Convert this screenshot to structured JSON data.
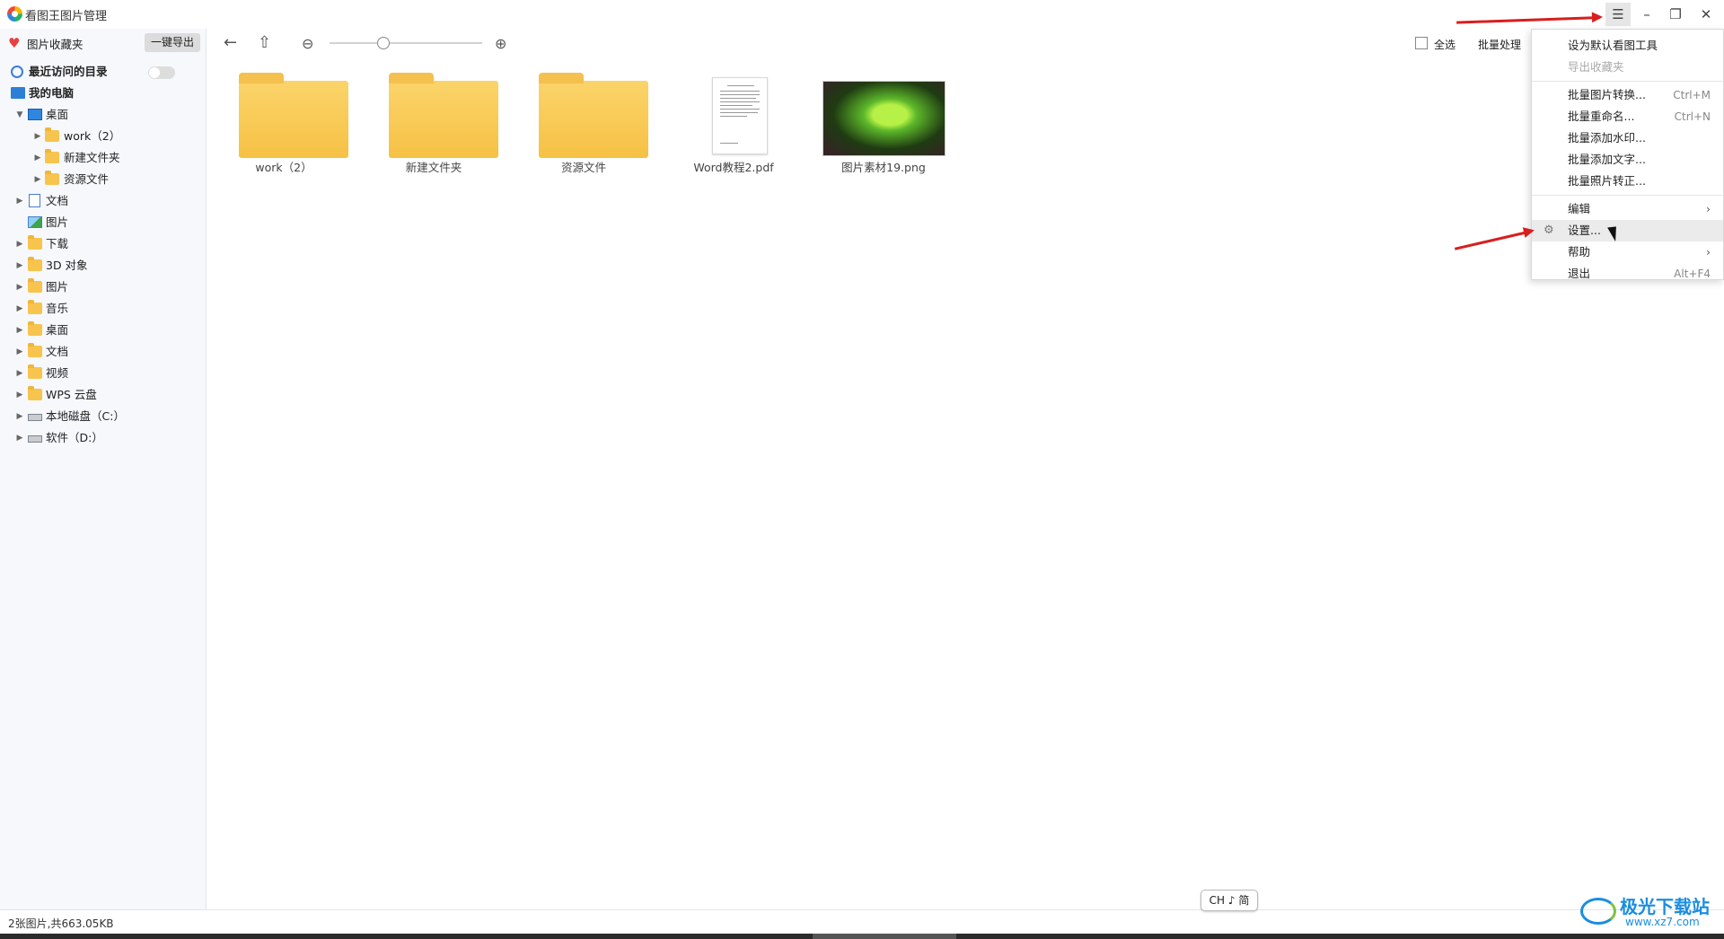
{
  "app": {
    "title": "看图王图片管理"
  },
  "sidebar": {
    "favorites_label": "图片收藏夹",
    "export_button": "一键导出",
    "recent_label": "最近访问的目录",
    "tree": [
      {
        "label": "我的电脑",
        "icon": "computer-icon"
      },
      {
        "label": "桌面",
        "icon": "desktop-icon"
      },
      {
        "label": "work（2）",
        "icon": "folder-icon"
      },
      {
        "label": "新建文件夹",
        "icon": "folder-icon"
      },
      {
        "label": "资源文件",
        "icon": "folder-icon"
      },
      {
        "label": "文档",
        "icon": "document-icon"
      },
      {
        "label": "图片",
        "icon": "picture-icon"
      },
      {
        "label": "下载",
        "icon": "folder-icon"
      },
      {
        "label": "3D 对象",
        "icon": "folder-icon"
      },
      {
        "label": "图片",
        "icon": "folder-icon"
      },
      {
        "label": "音乐",
        "icon": "folder-icon"
      },
      {
        "label": "桌面",
        "icon": "folder-icon"
      },
      {
        "label": "文档",
        "icon": "folder-icon"
      },
      {
        "label": "视频",
        "icon": "folder-icon"
      },
      {
        "label": "WPS 云盘",
        "icon": "folder-icon"
      },
      {
        "label": "本地磁盘（C:）",
        "icon": "drive-icon"
      },
      {
        "label": "软件（D:）",
        "icon": "drive-icon"
      }
    ]
  },
  "toolbar": {
    "select_all": "全选",
    "batch": "批量处理"
  },
  "files": [
    {
      "name": "work（2）",
      "kind": "folder"
    },
    {
      "name": "新建文件夹",
      "kind": "folder"
    },
    {
      "name": "资源文件",
      "kind": "folder"
    },
    {
      "name": "Word教程2.pdf",
      "kind": "pdf"
    },
    {
      "name": "图片素材19.png",
      "kind": "image"
    }
  ],
  "menu": {
    "items": [
      {
        "label": "设为默认看图工具",
        "shortcut": ""
      },
      {
        "label": "导出收藏夹",
        "shortcut": ""
      },
      {
        "label": "批量图片转换...",
        "shortcut": "Ctrl+M"
      },
      {
        "label": "批量重命名...",
        "shortcut": "Ctrl+N"
      },
      {
        "label": "批量添加水印...",
        "shortcut": ""
      },
      {
        "label": "批量添加文字...",
        "shortcut": ""
      },
      {
        "label": "批量照片转正...",
        "shortcut": ""
      },
      {
        "label": "编辑",
        "shortcut": ""
      },
      {
        "label": "设置...",
        "shortcut": ""
      },
      {
        "label": "帮助",
        "shortcut": ""
      },
      {
        "label": "退出",
        "shortcut": "Alt+F4"
      }
    ]
  },
  "status": {
    "text": "2张图片,共663.05KB"
  },
  "ime": {
    "text": "CH ♪ 简"
  },
  "watermark": {
    "brand": "极光下载站",
    "url": "www.xz7.com"
  },
  "colors": {
    "accent": "#2e86de",
    "annotation_arrow": "#d81e1e",
    "folder": "#f6c145"
  }
}
